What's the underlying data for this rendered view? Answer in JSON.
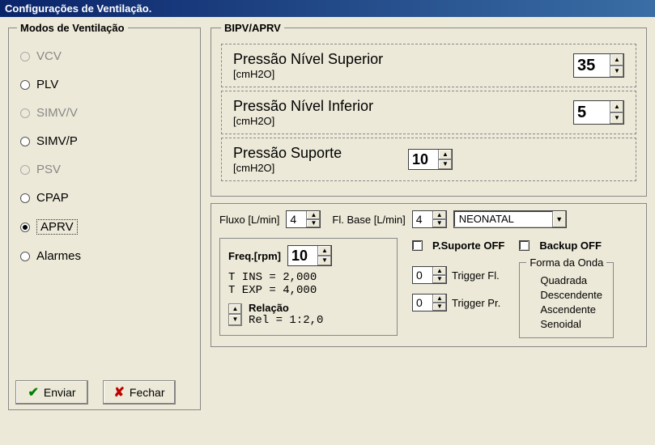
{
  "title": "Configurações de Ventilação.",
  "modes": {
    "legend": "Modos de Ventilação",
    "items": [
      {
        "label": "VCV",
        "enabled": false,
        "selected": false
      },
      {
        "label": "PLV",
        "enabled": true,
        "selected": false
      },
      {
        "label": "SIMV/V",
        "enabled": false,
        "selected": false
      },
      {
        "label": "SIMV/P",
        "enabled": true,
        "selected": false
      },
      {
        "label": "PSV",
        "enabled": false,
        "selected": false
      },
      {
        "label": "CPAP",
        "enabled": true,
        "selected": false
      },
      {
        "label": "APRV",
        "enabled": true,
        "selected": true
      },
      {
        "label": "Alarmes",
        "enabled": true,
        "selected": false
      }
    ]
  },
  "buttons": {
    "send": "Enviar",
    "close": "Fechar"
  },
  "bipv": {
    "legend": "BIPV/APRV",
    "upper": {
      "title": "Pressão Nível Superior",
      "unit": "[cmH2O]",
      "value": "35"
    },
    "lower": {
      "title": "Pressão Nível Inferior",
      "unit": "[cmH2O]",
      "value": "5"
    },
    "support": {
      "title": "Pressão Suporte",
      "unit": "[cmH2O]",
      "value": "10"
    }
  },
  "flux": {
    "label": "Fluxo [L/min]",
    "value": "4",
    "base_label": "Fl. Base [L/min]",
    "base_value": "4",
    "patient_type": "NEONATAL"
  },
  "freq": {
    "label": "Freq.[rpm]",
    "value": "10",
    "tins": "T INS = 2,000",
    "texp": "T EXP = 4,000",
    "rel_label": "Relação",
    "rel_value": "Rel = 1:2,0"
  },
  "psup": {
    "label": "P.Suporte OFF"
  },
  "trigger_fl": {
    "value": "0",
    "label": "Trigger Fl."
  },
  "trigger_pr": {
    "value": "0",
    "label": "Trigger Pr."
  },
  "backup": {
    "label": "Backup OFF"
  },
  "waveform": {
    "legend": "Forma da Onda",
    "options": [
      "Quadrada",
      "Descendente",
      "Ascendente",
      "Senoidal"
    ],
    "selected": "Quadrada"
  }
}
